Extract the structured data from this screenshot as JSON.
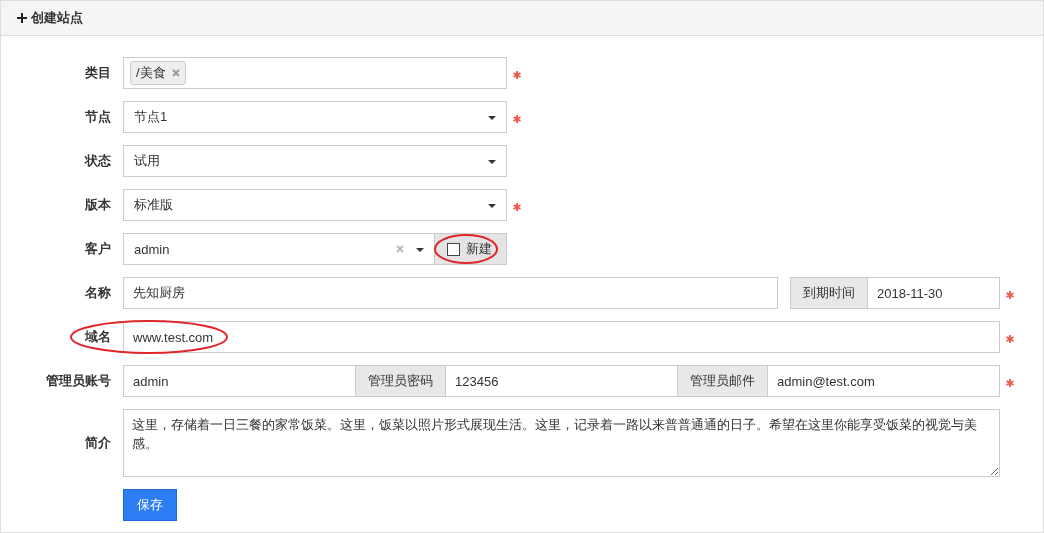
{
  "header": {
    "title": "创建站点"
  },
  "fields": [
    {
      "kind": "tags",
      "label": "类目",
      "tags": [
        {
          "text": "/美食"
        }
      ],
      "required": true
    },
    {
      "kind": "select",
      "label": "节点",
      "value": "节点1",
      "required": true
    },
    {
      "kind": "select",
      "label": "状态",
      "value": "试用",
      "required": false
    },
    {
      "kind": "select",
      "label": "版本",
      "value": "标准版",
      "required": true
    },
    {
      "kind": "combo",
      "label": "客户",
      "value": "admin",
      "checkbox": {
        "label": "新建",
        "checked": false,
        "circled": true
      },
      "required": false
    },
    {
      "kind": "inputs",
      "label": "名称",
      "required": true,
      "groups": [
        [
          {
            "kind": "input",
            "value": "先知厨房"
          }
        ],
        [
          {
            "kind": "addon",
            "text": "到期时间"
          },
          {
            "kind": "input",
            "value": "2018-11-30"
          }
        ]
      ]
    },
    {
      "kind": "inputs",
      "label": "域名",
      "circled": true,
      "required": true,
      "groups": [
        [
          {
            "kind": "input",
            "value": "www.test.com"
          }
        ]
      ]
    },
    {
      "kind": "inputs",
      "label": "管理员账号",
      "required": true,
      "groups": [
        [
          {
            "kind": "input",
            "value": "admin"
          },
          {
            "kind": "addon",
            "text": "管理员密码"
          },
          {
            "kind": "input",
            "value": "123456"
          },
          {
            "kind": "addon",
            "text": "管理员邮件"
          },
          {
            "kind": "input",
            "value": "admin@test.com"
          }
        ]
      ]
    },
    {
      "kind": "textarea",
      "label": "简介",
      "value": "这里，存储着一日三餐的家常饭菜。这里，饭菜以照片形式展现生活。这里，记录着一路以来普普通通的日子。希望在这里你能享受饭菜的视觉与美感。",
      "required": false
    }
  ],
  "save_button": "保存"
}
